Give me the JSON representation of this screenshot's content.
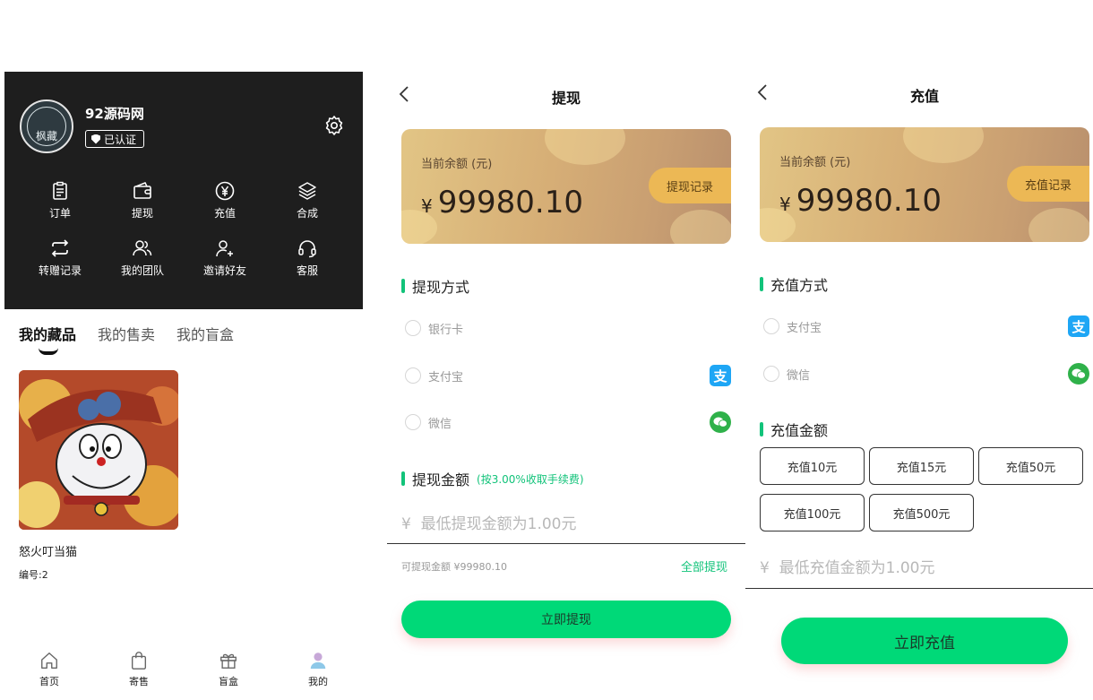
{
  "profile": {
    "avatar_text": "枫藏",
    "username": "92源码网",
    "verified_label": "已认证",
    "grid": [
      {
        "label": "订单",
        "icon": "order-icon"
      },
      {
        "label": "提现",
        "icon": "wallet-icon"
      },
      {
        "label": "充值",
        "icon": "yen-coin-icon"
      },
      {
        "label": "合成",
        "icon": "layers-icon"
      },
      {
        "label": "转赠记录",
        "icon": "transfer-icon"
      },
      {
        "label": "我的团队",
        "icon": "team-icon"
      },
      {
        "label": "邀请好友",
        "icon": "invite-icon"
      },
      {
        "label": "客服",
        "icon": "headset-icon"
      }
    ],
    "tabs": [
      "我的藏品",
      "我的售卖",
      "我的盲盒"
    ],
    "active_tab": "我的藏品",
    "card": {
      "name": "怒火叮当猫",
      "number": "编号:2"
    },
    "bottom_nav": [
      {
        "label": "首页",
        "icon": "home-icon"
      },
      {
        "label": "寄售",
        "icon": "bag-icon"
      },
      {
        "label": "盲盒",
        "icon": "gift-icon"
      },
      {
        "label": "我的",
        "icon": "user-icon"
      }
    ]
  },
  "withdraw": {
    "title": "提现",
    "balance_label": "当前余额 (元)",
    "currency": "¥",
    "balance": "99980.10",
    "record_button": "提现记录",
    "method_title": "提现方式",
    "methods": [
      "银行卡",
      "支付宝",
      "微信"
    ],
    "amount_title": "提现金额",
    "amount_hint": "(按3.00%收取手续费)",
    "amount_placeholder": "最低提现金额为1.00元",
    "available": "可提现金额 ¥99980.10",
    "withdraw_all": "全部提现",
    "submit": "立即提现"
  },
  "recharge": {
    "title": "充值",
    "balance_label": "当前余额 (元)",
    "currency": "¥",
    "balance": "99980.10",
    "record_button": "充值记录",
    "method_title": "充值方式",
    "methods": [
      "支付宝",
      "微信"
    ],
    "amount_title": "充值金额",
    "amounts": [
      "充值10元",
      "充值15元",
      "充值50元",
      "充值100元",
      "充值500元"
    ],
    "amount_placeholder": "最低充值金额为1.00元",
    "submit": "立即充值"
  },
  "colors": {
    "accent_green": "#00d978",
    "header_dark": "#1e1e1e",
    "gold_button": "#ecb855"
  }
}
